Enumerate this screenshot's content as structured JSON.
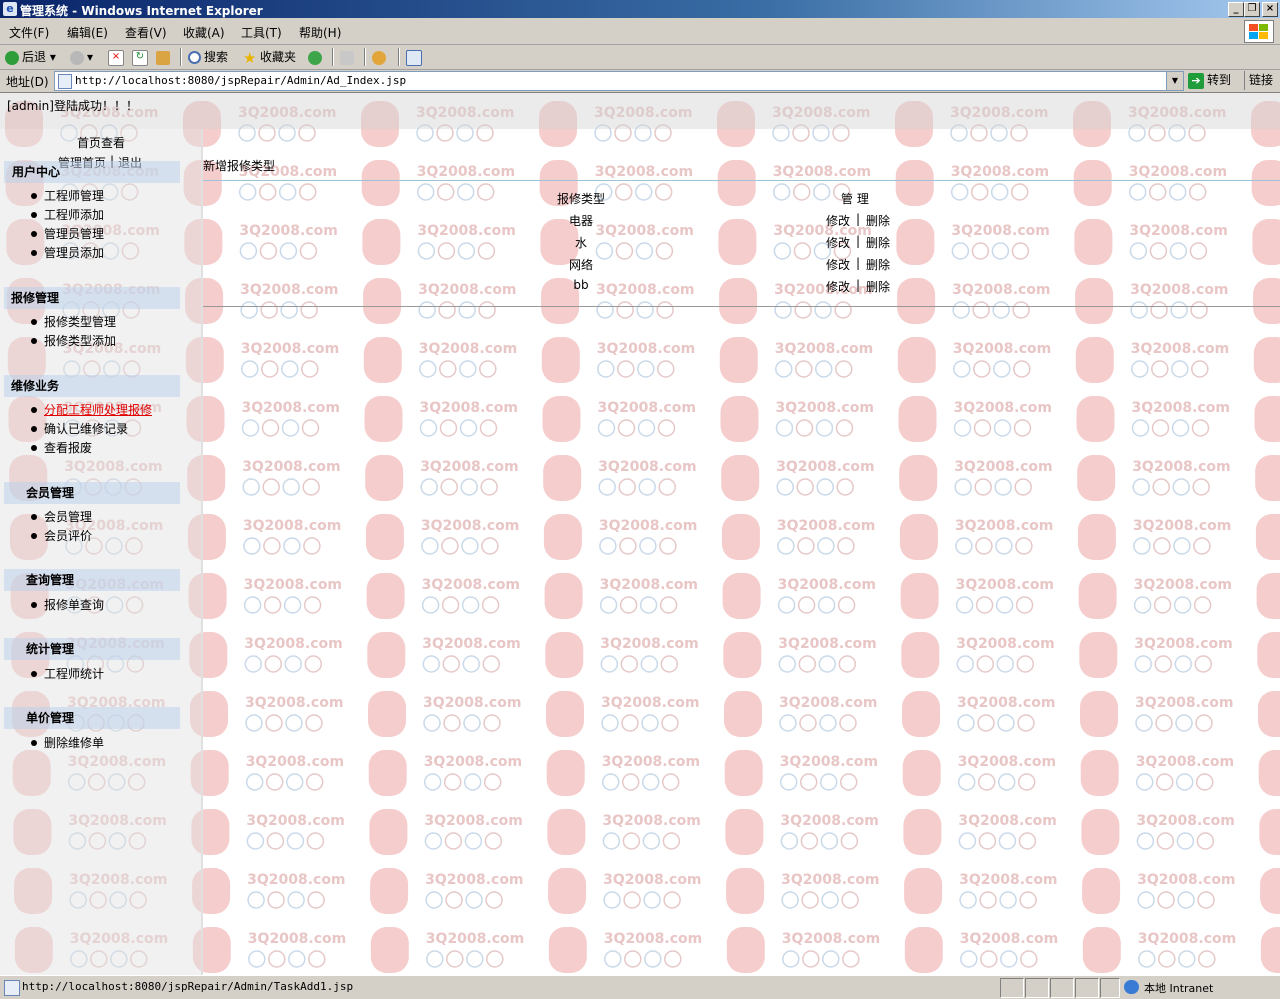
{
  "window": {
    "title": "管理系统 - Windows Internet Explorer",
    "icon": "ie-icon"
  },
  "menu": [
    "文件(F)",
    "编辑(E)",
    "查看(V)",
    "收藏(A)",
    "工具(T)",
    "帮助(H)"
  ],
  "toolbar": {
    "back_label": "后退",
    "search_label": "搜索",
    "favorites_label": "收藏夹"
  },
  "address": {
    "label": "地址(D)",
    "url": "http://localhost:8080/jspRepair/Admin/Ad_Index.jsp",
    "go_label": "转到",
    "links_label": "链接"
  },
  "page": {
    "login_message": "[admin]登陆成功！！！",
    "watermark_text": "3Q2008.com",
    "top_links": {
      "home_view": "首页查看",
      "admin_home": "管理首页",
      "separator": "|",
      "logout": "退出"
    },
    "sidebar": {
      "categories": [
        {
          "title": "用户中心",
          "items": [
            "工程师管理",
            "工程师添加",
            "管理员管理",
            "管理员添加"
          ]
        },
        {
          "title": "报修管理",
          "items": [
            "报修类型管理",
            "报修类型添加"
          ]
        },
        {
          "title": "维修业务",
          "items": [
            "分配工程师处理报修",
            "确认已维修记录",
            "查看报废"
          ]
        },
        {
          "title": "会员管理",
          "items": [
            "会员管理",
            "会员评价"
          ]
        },
        {
          "title": "查询管理",
          "items": [
            "报修单查询"
          ]
        },
        {
          "title": "统计管理",
          "items": [
            "工程师统计"
          ]
        },
        {
          "title": "单价管理",
          "items": [
            "删除维修单"
          ]
        }
      ],
      "active_item": "分配工程师处理报修"
    },
    "main": {
      "add_link": "新增报修类型",
      "table": {
        "headers": [
          "报修类型",
          "管 理"
        ],
        "rows": [
          "电器",
          "水",
          "网络",
          "bb"
        ],
        "edit_label": "修改",
        "separator": "|",
        "delete_label": "删除"
      }
    }
  },
  "status": {
    "url": "http://localhost:8080/jspRepair/Admin/TaskAdd1.jsp",
    "zone": "本地 Intranet"
  }
}
